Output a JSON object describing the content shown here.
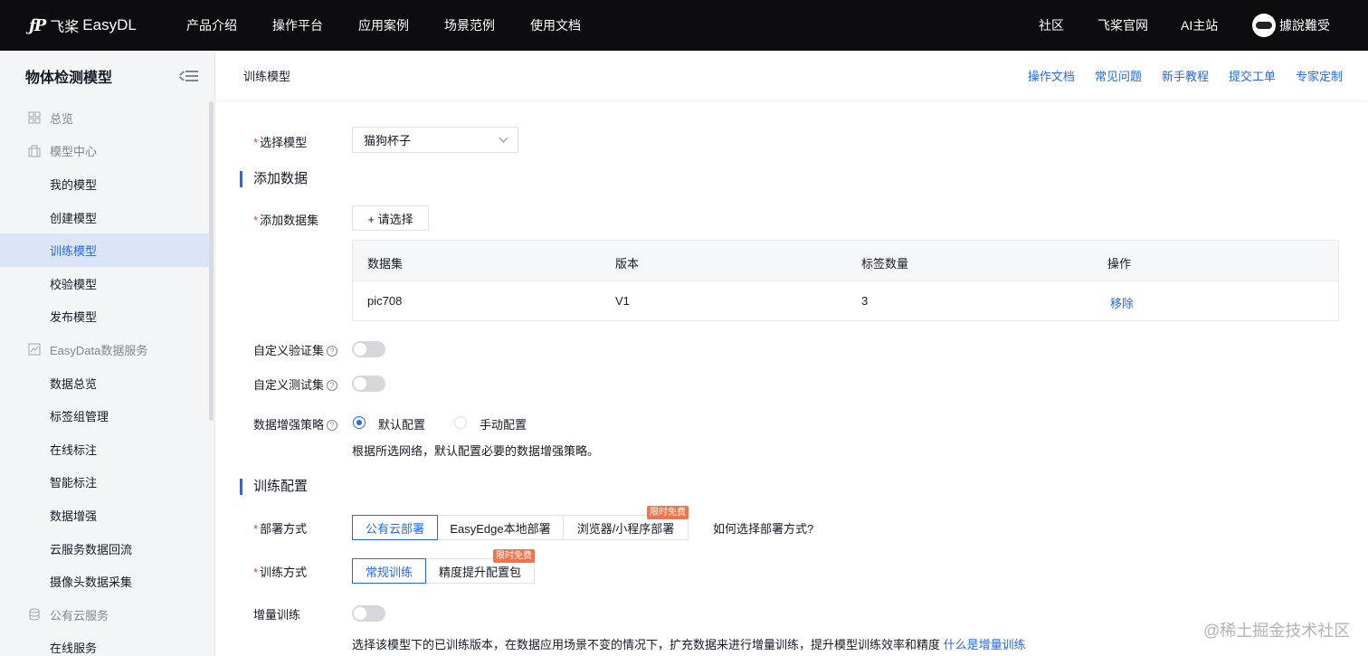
{
  "topbar": {
    "logo_mark": "ƒP",
    "logo_cn": "飞桨",
    "logo_en": "EasyDL",
    "nav": [
      "产品介绍",
      "操作平台",
      "应用案例",
      "场景范例",
      "使用文档"
    ],
    "right": [
      "社区",
      "飞桨官网",
      "AI主站"
    ],
    "user_name": "據說難受"
  },
  "sidebar": {
    "title": "物体检测模型",
    "items": [
      {
        "label": "总览",
        "type": "group",
        "icon": "grid-icon"
      },
      {
        "label": "模型中心",
        "type": "group",
        "icon": "building-icon"
      },
      {
        "label": "我的模型",
        "type": "child"
      },
      {
        "label": "创建模型",
        "type": "child"
      },
      {
        "label": "训练模型",
        "type": "child",
        "active": true
      },
      {
        "label": "校验模型",
        "type": "child"
      },
      {
        "label": "发布模型",
        "type": "child"
      },
      {
        "label": "EasyData数据服务",
        "type": "group",
        "icon": "chart-icon"
      },
      {
        "label": "数据总览",
        "type": "child"
      },
      {
        "label": "标签组管理",
        "type": "child"
      },
      {
        "label": "在线标注",
        "type": "child"
      },
      {
        "label": "智能标注",
        "type": "child"
      },
      {
        "label": "数据增强",
        "type": "child"
      },
      {
        "label": "云服务数据回流",
        "type": "child"
      },
      {
        "label": "摄像头数据采集",
        "type": "child"
      },
      {
        "label": "公有云服务",
        "type": "group",
        "icon": "database-icon"
      },
      {
        "label": "在线服务",
        "type": "child"
      }
    ]
  },
  "header": {
    "breadcrumb": "训练模型",
    "links": [
      "操作文档",
      "常见问题",
      "新手教程",
      "提交工单",
      "专家定制"
    ]
  },
  "form": {
    "select_model_label": "选择模型",
    "select_model_value": "猫狗杯子",
    "section_add_data": "添加数据",
    "add_dataset_label": "添加数据集",
    "add_dataset_button": "+ 请选择",
    "table": {
      "headers": [
        "数据集",
        "版本",
        "标签数量",
        "操作"
      ],
      "rows": [
        {
          "dataset": "pic708",
          "version": "V1",
          "labels": "3",
          "action": "移除"
        }
      ]
    },
    "custom_val_label": "自定义验证集",
    "custom_test_label": "自定义测试集",
    "augment_label": "数据增强策略",
    "augment_options": [
      "默认配置",
      "手动配置"
    ],
    "augment_hint": "根据所选网络，默认配置必要的数据增强策略。",
    "section_train_config": "训练配置",
    "deploy_label": "部署方式",
    "deploy_options": [
      "公有云部署",
      "EasyEdge本地部署",
      "浏览器/小程序部署"
    ],
    "deploy_tag": "限时免费",
    "deploy_help_link": "如何选择部署方式?",
    "train_mode_label": "训练方式",
    "train_mode_options": [
      "常规训练",
      "精度提升配置包"
    ],
    "train_mode_tag": "限时免费",
    "incremental_label": "增量训练",
    "incremental_hint": "选择该模型下的已训练版本，在数据应用场景不变的情况下，扩充数据来进行增量训练，提升模型训练效率和精度",
    "incremental_link": "什么是增量训练",
    "help_glyph": "?"
  },
  "watermark": "@稀土掘金技术社区",
  "colors": {
    "accent": "#2468f2",
    "topbar": "#0d0d0f",
    "tag": "#f2734a",
    "required": "#f33e3e"
  }
}
